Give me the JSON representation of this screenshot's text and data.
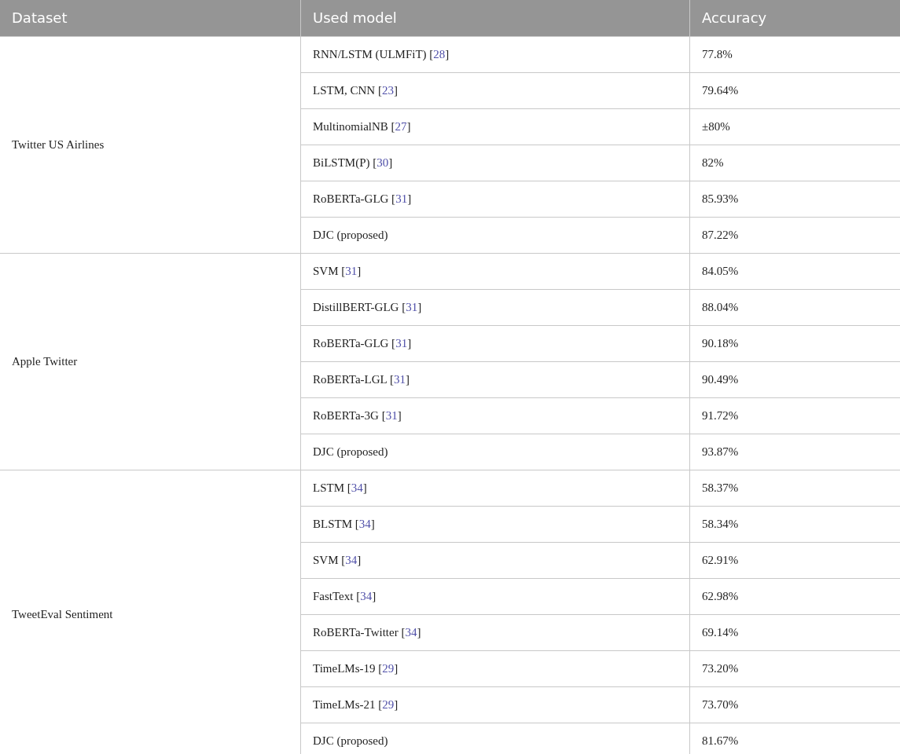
{
  "table": {
    "columns": [
      "Dataset",
      "Used model",
      "Accuracy"
    ],
    "groups": [
      {
        "dataset": "Twitter US Airlines",
        "rows": [
          {
            "model": "RNN/LSTM (ULMFiT) [",
            "ref": "28",
            "tail": "]",
            "accuracy": "77.8%"
          },
          {
            "model": "LSTM, CNN [",
            "ref": "23",
            "tail": "]",
            "accuracy": "79.64%"
          },
          {
            "model": "MultinomialNB [",
            "ref": "27",
            "tail": "]",
            "accuracy": "±80%"
          },
          {
            "model": "BiLSTM(P) [",
            "ref": "30",
            "tail": "]",
            "accuracy": "82%"
          },
          {
            "model": "RoBERTa-GLG [",
            "ref": "31",
            "tail": "]",
            "accuracy": "85.93%"
          },
          {
            "model": "DJC (proposed)",
            "accuracy": "87.22%"
          }
        ]
      },
      {
        "dataset": "Apple Twitter",
        "rows": [
          {
            "model": "SVM [",
            "ref": "31",
            "tail": "]",
            "accuracy": "84.05%"
          },
          {
            "model": "DistillBERT-GLG [",
            "ref": "31",
            "tail": "]",
            "accuracy": "88.04%"
          },
          {
            "model": "RoBERTa-GLG [",
            "ref": "31",
            "tail": "]",
            "accuracy": "90.18%"
          },
          {
            "model": "RoBERTa-LGL [",
            "ref": "31",
            "tail": "]",
            "accuracy": "90.49%"
          },
          {
            "model": "RoBERTa-3G [",
            "ref": "31",
            "tail": "]",
            "accuracy": "91.72%"
          },
          {
            "model": "DJC (proposed)",
            "accuracy": "93.87%"
          }
        ]
      },
      {
        "dataset": "TweetEval Sentiment",
        "rows": [
          {
            "model": "LSTM [",
            "ref": "34",
            "tail": "]",
            "accuracy": "58.37%"
          },
          {
            "model": "BLSTM [",
            "ref": "34",
            "tail": "]",
            "accuracy": "58.34%"
          },
          {
            "model": "SVM [",
            "ref": "34",
            "tail": "]",
            "accuracy": "62.91%"
          },
          {
            "model": "FastText [",
            "ref": "34",
            "tail": "]",
            "accuracy": "62.98%"
          },
          {
            "model": "RoBERTa-Twitter [",
            "ref": "34",
            "tail": "]",
            "accuracy": "69.14%"
          },
          {
            "model": "TimeLMs-19 [",
            "ref": "29",
            "tail": "]",
            "accuracy": "73.20%"
          },
          {
            "model": "TimeLMs-21 [",
            "ref": "29",
            "tail": "]",
            "accuracy": "73.70%"
          },
          {
            "model": "DJC (proposed)",
            "accuracy": "81.67%"
          }
        ]
      }
    ]
  }
}
